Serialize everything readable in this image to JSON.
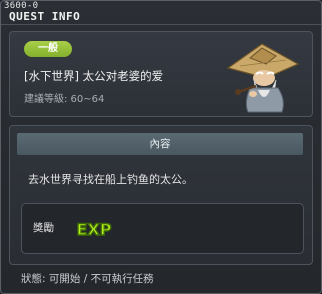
{
  "window": {
    "id": "3600-0",
    "title": "QUEST INFO"
  },
  "quest": {
    "category": "一般",
    "name": "[水下世界] 太公对老婆的爱",
    "level": "建議等級: 60~64"
  },
  "content": {
    "header": "內容",
    "description": "去水世界寻找在船上钓鱼的太公。"
  },
  "reward": {
    "label": "獎勵",
    "item": "EXP"
  },
  "status": "狀態: 可開始 / 不可執行任務",
  "icons": {
    "npc": "old-fisherman-npc-icon",
    "reward": "exp-icon"
  },
  "colors": {
    "badge": "#94be38",
    "exp": "#b6f01e"
  }
}
